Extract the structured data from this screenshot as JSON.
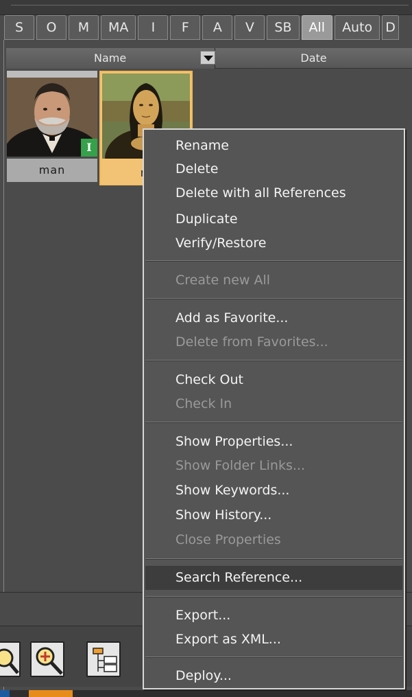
{
  "tabs": [
    "S",
    "O",
    "M",
    "MA",
    "I",
    "F",
    "A",
    "V",
    "SB",
    "All",
    "Auto",
    "D"
  ],
  "active_tab": "All",
  "columns": {
    "name": "Name",
    "date": "Date"
  },
  "thumbnails": [
    {
      "caption": "man",
      "badge": "I"
    },
    {
      "caption": "m"
    }
  ],
  "menu": [
    {
      "label": "Rename",
      "enabled": true
    },
    {
      "label": "Delete",
      "enabled": true
    },
    {
      "label": "Delete with all References",
      "enabled": true
    },
    {
      "label": "Duplicate",
      "enabled": true
    },
    {
      "label": "Verify/Restore",
      "enabled": true
    },
    {
      "label": "Create new All",
      "enabled": false
    },
    {
      "label": "Add as Favorite...",
      "enabled": true
    },
    {
      "label": "Delete from Favorites...",
      "enabled": false
    },
    {
      "label": "Check Out",
      "enabled": true
    },
    {
      "label": "Check In",
      "enabled": false
    },
    {
      "label": "Show Properties...",
      "enabled": true
    },
    {
      "label": "Show Folder Links...",
      "enabled": false
    },
    {
      "label": "Show Keywords...",
      "enabled": true
    },
    {
      "label": "Show History...",
      "enabled": true
    },
    {
      "label": "Close Properties",
      "enabled": false
    },
    {
      "label": "Search Reference...",
      "enabled": true,
      "highlighted": true
    },
    {
      "label": "Export...",
      "enabled": true
    },
    {
      "label": "Export as XML...",
      "enabled": true
    },
    {
      "label": "Deploy...",
      "enabled": true
    }
  ],
  "toolbar": [
    "zoom-out-icon",
    "zoom-in-icon",
    "tree-view-icon"
  ],
  "colors": {
    "background": "#4b4b4b",
    "menu_bg": "#555555",
    "selected_thumb": "#f5c36f",
    "badge": "#37a04a",
    "disabled_text": "#9a9a9a"
  }
}
